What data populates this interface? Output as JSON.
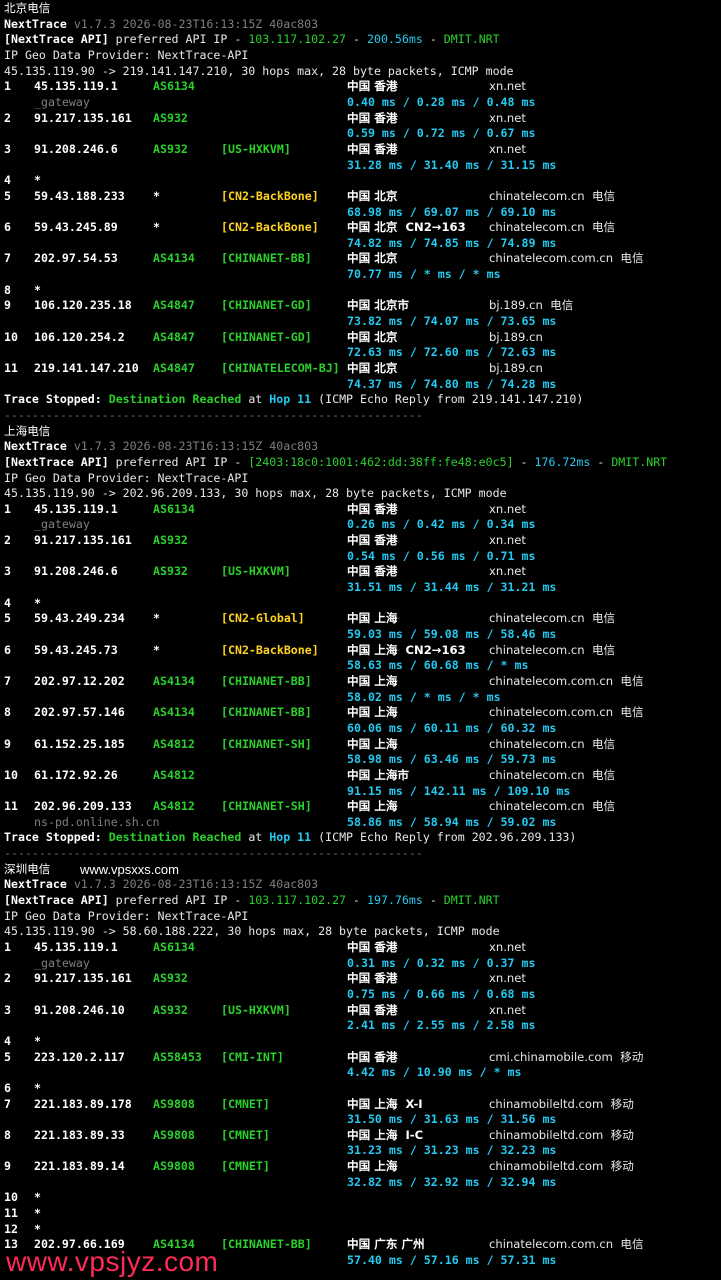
{
  "separator": "------------------------------------------------------------",
  "watermark": "www.vpsjyz.com",
  "overlay_domain": "www.vpsxxs.com",
  "sections": [
    {
      "title": "北京电信",
      "nt_name": "NextTrace",
      "version": "v1.7.3 2026-08-23T16:13:15Z 40ac803",
      "api_label": "[NextTrace API]",
      "api_text": " preferred API IP - ",
      "api_ip": "103.117.102.27",
      "api_latency": "200.56ms",
      "api_node": "DMIT.NRT",
      "geo_line": "IP Geo Data Provider: NextTrace-API",
      "trace_line": "45.135.119.90 -> 219.141.147.210, 30 hops max, 28 byte packets, ICMP mode",
      "hops": [
        {
          "n": "1",
          "ip": "45.135.119.1",
          "as": "AS6134",
          "tag": "",
          "geo": "中国 香港",
          "isp": "xn.net",
          "sub": "_gateway",
          "rtt": "0.40 ms / 0.28 ms / 0.48 ms"
        },
        {
          "n": "2",
          "ip": "91.217.135.161",
          "as": "AS932",
          "tag": "",
          "geo": "中国 香港",
          "isp": "xn.net",
          "sub": "",
          "rtt": "0.59 ms / 0.72 ms / 0.67 ms"
        },
        {
          "n": "3",
          "ip": "91.208.246.6",
          "as": "AS932",
          "tag": "[US-HXKVM]",
          "geo": "中国 香港",
          "isp": "xn.net",
          "sub": "",
          "rtt": "31.28 ms / 31.40 ms / 31.15 ms"
        },
        {
          "n": "4",
          "ip": "*",
          "as": "",
          "tag": "",
          "geo": "",
          "isp": "",
          "sub": "",
          "rtt": ""
        },
        {
          "n": "5",
          "ip": "59.43.188.233",
          "as": "*",
          "tag": "[CN2-BackBone]",
          "geo": "中国 北京",
          "isp": "chinatelecom.cn  电信",
          "sub": "",
          "rtt": "68.98 ms / 69.07 ms / 69.10 ms"
        },
        {
          "n": "6",
          "ip": "59.43.245.89",
          "as": "*",
          "tag": "[CN2-BackBone]",
          "geo": "中国 北京  CN2→163",
          "isp": "chinatelecom.cn  电信",
          "sub": "",
          "rtt": "74.82 ms / 74.85 ms / 74.89 ms"
        },
        {
          "n": "7",
          "ip": "202.97.54.53",
          "as": "AS4134",
          "tag": "[CHINANET-BB]",
          "geo": "中国 北京",
          "isp": "chinatelecom.com.cn  电信",
          "sub": "",
          "rtt": "70.77 ms / * ms / * ms"
        },
        {
          "n": "8",
          "ip": "*",
          "as": "",
          "tag": "",
          "geo": "",
          "isp": "",
          "sub": "",
          "rtt": ""
        },
        {
          "n": "9",
          "ip": "106.120.235.18",
          "as": "AS4847",
          "tag": "[CHINANET-GD]",
          "geo": "中国 北京市",
          "isp": "bj.189.cn  电信",
          "sub": "",
          "rtt": "73.82 ms / 74.07 ms / 73.65 ms"
        },
        {
          "n": "10",
          "ip": "106.120.254.2",
          "as": "AS4847",
          "tag": "[CHINANET-GD]",
          "geo": "中国 北京",
          "isp": "bj.189.cn",
          "sub": "",
          "rtt": "72.63 ms / 72.60 ms / 72.63 ms"
        },
        {
          "n": "11",
          "ip": "219.141.147.210",
          "as": "AS4847",
          "tag": "[CHINATELECOM-BJ]",
          "geo": "中国 北京",
          "isp": "bj.189.cn",
          "sub": "",
          "rtt": "74.37 ms / 74.80 ms / 74.28 ms"
        }
      ],
      "stop_label": "Trace Stopped:",
      "stop_reached": "Destination Reached",
      "stop_at": " at ",
      "stop_hop": "Hop 11",
      "stop_tail": " (ICMP Echo Reply from 219.141.147.210)"
    },
    {
      "title": "上海电信",
      "nt_name": "NextTrace",
      "version": "v1.7.3 2026-08-23T16:13:15Z 40ac803",
      "api_label": "[NextTrace API]",
      "api_text": " preferred API IP - ",
      "api_ip": "[2403:18c0:1001:462:dd:38ff:fe48:e0c5]",
      "api_latency": "176.72ms",
      "api_node": "DMIT.NRT",
      "geo_line": "IP Geo Data Provider: NextTrace-API",
      "trace_line": "45.135.119.90 -> 202.96.209.133, 30 hops max, 28 byte packets, ICMP mode",
      "hops": [
        {
          "n": "1",
          "ip": "45.135.119.1",
          "as": "AS6134",
          "tag": "",
          "geo": "中国 香港",
          "isp": "xn.net",
          "sub": "_gateway",
          "rtt": "0.26 ms / 0.42 ms / 0.34 ms"
        },
        {
          "n": "2",
          "ip": "91.217.135.161",
          "as": "AS932",
          "tag": "",
          "geo": "中国 香港",
          "isp": "xn.net",
          "sub": "",
          "rtt": "0.54 ms / 0.56 ms / 0.71 ms"
        },
        {
          "n": "3",
          "ip": "91.208.246.6",
          "as": "AS932",
          "tag": "[US-HXKVM]",
          "geo": "中国 香港",
          "isp": "xn.net",
          "sub": "",
          "rtt": "31.51 ms / 31.44 ms / 31.21 ms"
        },
        {
          "n": "4",
          "ip": "*",
          "as": "",
          "tag": "",
          "geo": "",
          "isp": "",
          "sub": "",
          "rtt": ""
        },
        {
          "n": "5",
          "ip": "59.43.249.234",
          "as": "*",
          "tag": "[CN2-Global]",
          "geo": "中国 上海",
          "isp": "chinatelecom.cn  电信",
          "sub": "",
          "rtt": "59.03 ms / 59.08 ms / 58.46 ms"
        },
        {
          "n": "6",
          "ip": "59.43.245.73",
          "as": "*",
          "tag": "[CN2-BackBone]",
          "geo": "中国 上海  CN2→163",
          "isp": "chinatelecom.cn  电信",
          "sub": "",
          "rtt": "58.63 ms / 60.68 ms / * ms"
        },
        {
          "n": "7",
          "ip": "202.97.12.202",
          "as": "AS4134",
          "tag": "[CHINANET-BB]",
          "geo": "中国 上海",
          "isp": "chinatelecom.com.cn  电信",
          "sub": "",
          "rtt": "58.02 ms / * ms / * ms"
        },
        {
          "n": "8",
          "ip": "202.97.57.146",
          "as": "AS4134",
          "tag": "[CHINANET-BB]",
          "geo": "中国 上海",
          "isp": "chinatelecom.com.cn  电信",
          "sub": "",
          "rtt": "60.06 ms / 60.11 ms / 60.32 ms"
        },
        {
          "n": "9",
          "ip": "61.152.25.185",
          "as": "AS4812",
          "tag": "[CHINANET-SH]",
          "geo": "中国 上海",
          "isp": "chinatelecom.cn  电信",
          "sub": "",
          "rtt": "58.98 ms / 63.46 ms / 59.73 ms"
        },
        {
          "n": "10",
          "ip": "61.172.92.26",
          "as": "AS4812",
          "tag": "",
          "geo": "中国 上海市",
          "isp": "chinatelecom.cn  电信",
          "sub": "",
          "rtt": "91.15 ms / 142.11 ms / 109.10 ms"
        },
        {
          "n": "11",
          "ip": "202.96.209.133",
          "as": "AS4812",
          "tag": "[CHINANET-SH]",
          "geo": "中国 上海",
          "isp": "chinatelecom.cn  电信",
          "sub": "ns-pd.online.sh.cn",
          "rtt": "58.86 ms / 58.94 ms / 59.02 ms"
        }
      ],
      "stop_label": "Trace Stopped:",
      "stop_reached": "Destination Reached",
      "stop_at": " at ",
      "stop_hop": "Hop 11",
      "stop_tail": " (ICMP Echo Reply from 202.96.209.133)"
    },
    {
      "title": "深圳电信",
      "nt_name": "NextTrace",
      "version": "v1.7.3 2026-08-23T16:13:15Z 40ac803",
      "api_label": "[NextTrace API]",
      "api_text": " preferred API IP - ",
      "api_ip": "103.117.102.27",
      "api_latency": "197.76ms",
      "api_node": "DMIT.NRT",
      "geo_line": "IP Geo Data Provider: NextTrace-API",
      "trace_line": "45.135.119.90 -> 58.60.188.222, 30 hops max, 28 byte packets, ICMP mode",
      "hops": [
        {
          "n": "1",
          "ip": "45.135.119.1",
          "as": "AS6134",
          "tag": "",
          "geo": "中国 香港",
          "isp": "xn.net",
          "sub": "_gateway",
          "rtt": "0.31 ms / 0.32 ms / 0.37 ms"
        },
        {
          "n": "2",
          "ip": "91.217.135.161",
          "as": "AS932",
          "tag": "",
          "geo": "中国 香港",
          "isp": "xn.net",
          "sub": "",
          "rtt": "0.75 ms / 0.66 ms / 0.68 ms"
        },
        {
          "n": "3",
          "ip": "91.208.246.10",
          "as": "AS932",
          "tag": "[US-HXKVM]",
          "geo": "中国 香港",
          "isp": "xn.net",
          "sub": "",
          "rtt": "2.41 ms / 2.55 ms / 2.58 ms"
        },
        {
          "n": "4",
          "ip": "*",
          "as": "",
          "tag": "",
          "geo": "",
          "isp": "",
          "sub": "",
          "rtt": ""
        },
        {
          "n": "5",
          "ip": "223.120.2.117",
          "as": "AS58453",
          "tag": "[CMI-INT]",
          "geo": "中国 香港",
          "isp": "cmi.chinamobile.com  移动",
          "sub": "",
          "rtt": "4.42 ms / 10.90 ms / * ms"
        },
        {
          "n": "6",
          "ip": "*",
          "as": "",
          "tag": "",
          "geo": "",
          "isp": "",
          "sub": "",
          "rtt": ""
        },
        {
          "n": "7",
          "ip": "221.183.89.178",
          "as": "AS9808",
          "tag": "[CMNET]",
          "geo": "中国 上海  X-I",
          "isp": "chinamobileltd.com  移动",
          "sub": "",
          "rtt": "31.50 ms / 31.63 ms / 31.56 ms"
        },
        {
          "n": "8",
          "ip": "221.183.89.33",
          "as": "AS9808",
          "tag": "[CMNET]",
          "geo": "中国 上海  I-C",
          "isp": "chinamobileltd.com  移动",
          "sub": "",
          "rtt": "31.23 ms / 31.23 ms / 32.23 ms"
        },
        {
          "n": "9",
          "ip": "221.183.89.14",
          "as": "AS9808",
          "tag": "[CMNET]",
          "geo": "中国 上海",
          "isp": "chinamobileltd.com  移动",
          "sub": "",
          "rtt": "32.82 ms / 32.92 ms / 32.94 ms"
        },
        {
          "n": "10",
          "ip": "*",
          "as": "",
          "tag": "",
          "geo": "",
          "isp": "",
          "sub": "",
          "rtt": ""
        },
        {
          "n": "11",
          "ip": "*",
          "as": "",
          "tag": "",
          "geo": "",
          "isp": "",
          "sub": "",
          "rtt": ""
        },
        {
          "n": "12",
          "ip": "*",
          "as": "",
          "tag": "",
          "geo": "",
          "isp": "",
          "sub": "",
          "rtt": ""
        },
        {
          "n": "13",
          "ip": "202.97.66.169",
          "as": "AS4134",
          "tag": "[CHINANET-BB]",
          "geo": "中国 广东 广州",
          "isp": "chinatelecom.com.cn  电信",
          "sub": "",
          "rtt": "57.40 ms / 57.16 ms / 57.31 ms"
        }
      ]
    }
  ]
}
